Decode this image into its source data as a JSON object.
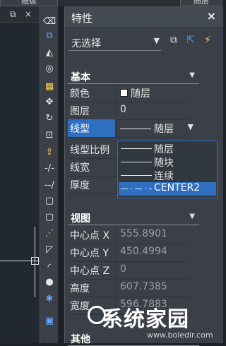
{
  "top_tabs": [
    "随返",
    "随层"
  ],
  "canvas": {
    "restore_glyph": "⧉",
    "close_glyph": "×"
  },
  "toolbar_icons": [
    {
      "name": "eraser-icon",
      "glyph": "⌫",
      "tone": ""
    },
    {
      "name": "copy-icon",
      "glyph": "⧉",
      "tone": "blue"
    },
    {
      "name": "mirror-icon",
      "glyph": "◭",
      "tone": ""
    },
    {
      "name": "offset-icon",
      "glyph": "◎",
      "tone": ""
    },
    {
      "name": "array-icon",
      "glyph": "▦",
      "tone": "yellow"
    },
    {
      "name": "move-icon",
      "glyph": "✥",
      "tone": ""
    },
    {
      "name": "rotate-icon",
      "glyph": "↻",
      "tone": ""
    },
    {
      "name": "scale-icon",
      "glyph": "⊡",
      "tone": ""
    },
    {
      "name": "stretch-icon",
      "glyph": "⇪",
      "tone": "yellow"
    },
    {
      "name": "trim-icon",
      "glyph": "-/-",
      "tone": ""
    },
    {
      "name": "extend-icon",
      "glyph": "--/",
      "tone": ""
    },
    {
      "name": "break-point-icon",
      "glyph": "▢",
      "tone": ""
    },
    {
      "name": "break-icon",
      "glyph": "▢",
      "tone": ""
    },
    {
      "name": "join-icon",
      "glyph": "⋰",
      "tone": "yellow"
    },
    {
      "name": "chamfer-icon",
      "glyph": "◸",
      "tone": ""
    },
    {
      "name": "fillet-icon",
      "glyph": "◜",
      "tone": ""
    },
    {
      "name": "blend-icon",
      "glyph": "●",
      "tone": ""
    },
    {
      "name": "explode-icon",
      "glyph": "✱",
      "tone": "blue"
    },
    {
      "name": "layers-icon",
      "glyph": "▣",
      "tone": "blue"
    }
  ],
  "panel": {
    "title": "特性",
    "close_label": "×",
    "selection": "无选择",
    "sections": {
      "basic": "基本",
      "view": "视图",
      "misc": "其他"
    },
    "basic_rows": [
      {
        "key": "颜色",
        "value": "随层"
      },
      {
        "key": "图层",
        "value": "0"
      },
      {
        "key": "线型",
        "value": "随层"
      },
      {
        "key": "线型比例",
        "value": ""
      },
      {
        "key": "线宽",
        "value": ""
      },
      {
        "key": "厚度",
        "value": ""
      }
    ],
    "linetype_options": [
      "随层",
      "随块",
      "连续",
      "CENTER2"
    ],
    "view_rows": [
      {
        "key": "中心点 X",
        "value": "555.8901"
      },
      {
        "key": "中心点 Y",
        "value": "450.4994"
      },
      {
        "key": "中心点 Z",
        "value": "0"
      },
      {
        "key": "高度",
        "value": "607.7385"
      },
      {
        "key": "宽度",
        "value": "596.7883"
      }
    ]
  },
  "watermark": {
    "text": "系统家园",
    "url": "www.boledir.com"
  },
  "colors": {
    "highlight": "#2f6fc0",
    "panel_bg": "#3b4048"
  }
}
